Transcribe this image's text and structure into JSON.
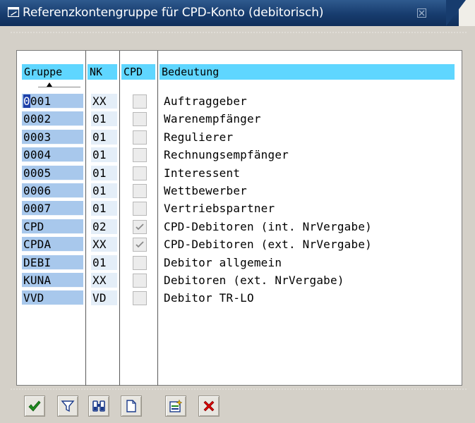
{
  "window": {
    "title": "Referenzkontengruppe für CPD-Konto (debitorisch)"
  },
  "table": {
    "columns": [
      "Gruppe",
      "NK",
      "CPD",
      "Bedeutung"
    ],
    "rows": [
      {
        "gruppe": "0001",
        "nk": "XX",
        "cpd": false,
        "bedeutung": "Auftraggeber"
      },
      {
        "gruppe": "0002",
        "nk": "01",
        "cpd": false,
        "bedeutung": "Warenempfänger"
      },
      {
        "gruppe": "0003",
        "nk": "01",
        "cpd": false,
        "bedeutung": "Regulierer"
      },
      {
        "gruppe": "0004",
        "nk": "01",
        "cpd": false,
        "bedeutung": "Rechnungsempfänger"
      },
      {
        "gruppe": "0005",
        "nk": "01",
        "cpd": false,
        "bedeutung": "Interessent"
      },
      {
        "gruppe": "0006",
        "nk": "01",
        "cpd": false,
        "bedeutung": "Wettbewerber"
      },
      {
        "gruppe": "0007",
        "nk": "01",
        "cpd": false,
        "bedeutung": "Vertriebspartner"
      },
      {
        "gruppe": "CPD",
        "nk": "02",
        "cpd": true,
        "bedeutung": "CPD-Debitoren (int. NrVergabe)"
      },
      {
        "gruppe": "CPDA",
        "nk": "XX",
        "cpd": true,
        "bedeutung": "CPD-Debitoren (ext. NrVergabe)"
      },
      {
        "gruppe": "DEBI",
        "nk": "01",
        "cpd": false,
        "bedeutung": "Debitor allgemein"
      },
      {
        "gruppe": "KUNA",
        "nk": "XX",
        "cpd": false,
        "bedeutung": "Debitoren (ext. NrVergabe)"
      },
      {
        "gruppe": "VVD",
        "nk": "VD",
        "cpd": false,
        "bedeutung": "Debitor TR-LO"
      }
    ]
  },
  "toolbar": {
    "buttons": [
      {
        "icon": "checkmark-icon",
        "action": "enter"
      },
      {
        "icon": "filter-icon",
        "action": "filter"
      },
      {
        "icon": "binoculars-icon",
        "action": "find"
      },
      {
        "icon": "new-document-icon",
        "action": "new"
      },
      {
        "icon": "new-entry-icon",
        "action": "create"
      },
      {
        "icon": "cancel-x-icon",
        "action": "cancel"
      }
    ]
  },
  "colors": {
    "titlebar": "#173c6e",
    "header_bg": "#5fd6ff",
    "key_column_bg": "#a8c8ec",
    "cancel_red": "#d40000",
    "confirm_green": "#1f8a1f"
  }
}
